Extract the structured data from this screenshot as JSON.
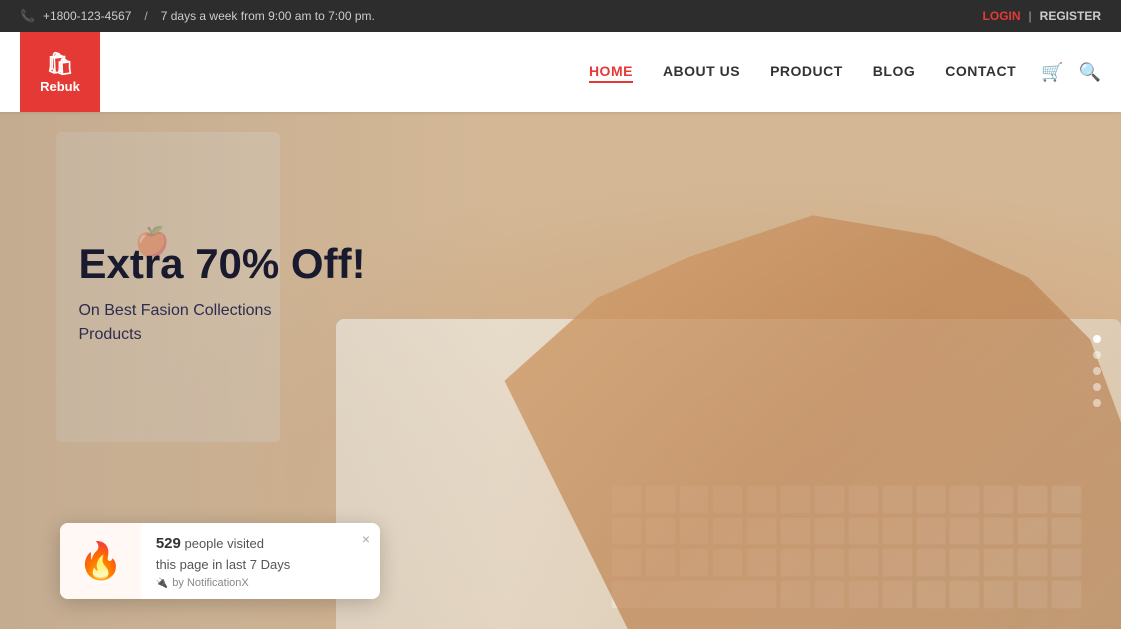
{
  "topbar": {
    "phone_icon": "📞",
    "phone": "+1800-123-4567",
    "divider": "/",
    "hours": "7 days a week from 9:00 am to 7:00 pm.",
    "login": "LOGIN",
    "separator": "|",
    "register": "REGISTER"
  },
  "navbar": {
    "logo_icon": "🛍",
    "logo_text": "Rebuk",
    "nav_items": [
      {
        "label": "HOME",
        "active": true
      },
      {
        "label": "ABOUT US",
        "active": false
      },
      {
        "label": "PRODUCT",
        "active": false
      },
      {
        "label": "BLOG",
        "active": false
      },
      {
        "label": "CONTACT",
        "active": false
      }
    ],
    "cart_icon": "🛒",
    "search_icon": "🔍"
  },
  "hero": {
    "title": "Extra 70% Off!",
    "subtitle_line1": "On Best Fasion Collections",
    "subtitle_line2": "Products"
  },
  "slider": {
    "dots": [
      {
        "active": true
      },
      {
        "active": false
      },
      {
        "active": false
      },
      {
        "active": false
      },
      {
        "active": false
      }
    ]
  },
  "notification": {
    "fire_emoji": "🔥",
    "count": "529",
    "text": "people visited",
    "subtext": "this page in last 7 Days",
    "plugin_icon": "🔌",
    "plugin_text": "by NotificationX",
    "close_icon": "×"
  }
}
